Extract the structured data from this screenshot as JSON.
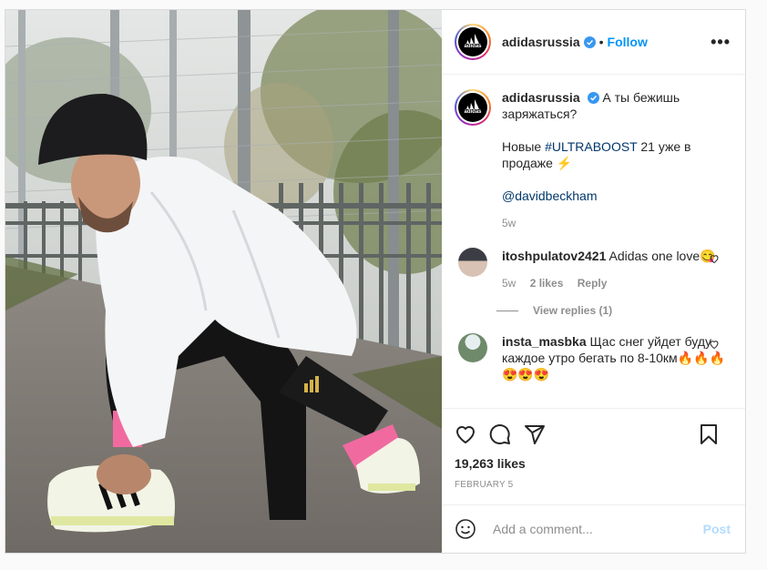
{
  "post": {
    "username": "adidasrussia",
    "follow_label": "Follow",
    "separator": "•",
    "more_label": "•••",
    "brand_word": "adidas"
  },
  "caption": {
    "username": "adidasrussia",
    "line1": "А ты бежишь заряжаться?",
    "line2_prefix": "Новые ",
    "hashtag": "#ULTRABOOST",
    "line2_suffix": " 21 уже в продаже ⚡",
    "mention": "@davidbeckham",
    "time": "5w"
  },
  "comments": [
    {
      "username": "itoshpulatov2421",
      "text": "Adidas one love😋",
      "time": "5w",
      "likes": "2 likes",
      "reply_label": "Reply",
      "view_replies": "View replies (1)"
    },
    {
      "username": "insta_masbka",
      "text": "Щас снег уйдет буду каждое утро бегать по 8-10км🔥🔥🔥😍😍😍"
    }
  ],
  "footer": {
    "likes": "19,263 likes",
    "date": "FEBRUARY 5",
    "comment_placeholder": "Add a comment...",
    "post_label": "Post"
  },
  "colors": {
    "accent": "#0095f6",
    "post_disabled": "#b3dbff",
    "muted": "#8e8e8e"
  }
}
